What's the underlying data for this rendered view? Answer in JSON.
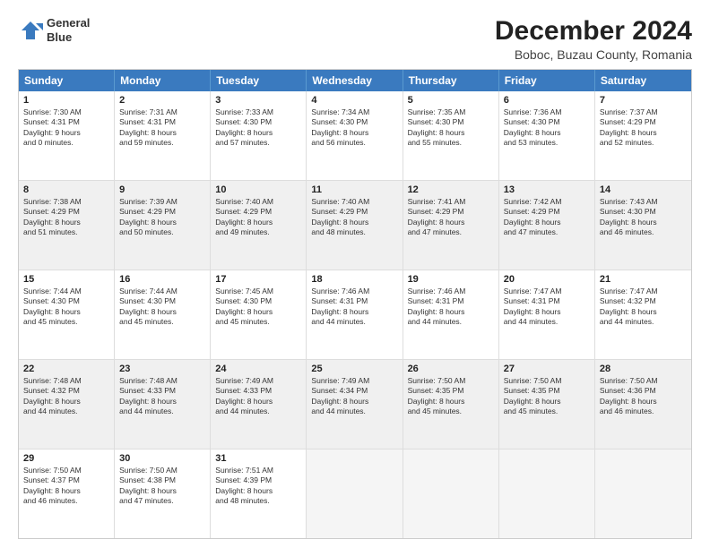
{
  "logo": {
    "line1": "General",
    "line2": "Blue"
  },
  "title": "December 2024",
  "subtitle": "Boboc, Buzau County, Romania",
  "header_days": [
    "Sunday",
    "Monday",
    "Tuesday",
    "Wednesday",
    "Thursday",
    "Friday",
    "Saturday"
  ],
  "rows": [
    [
      {
        "day": "1",
        "lines": [
          "Sunrise: 7:30 AM",
          "Sunset: 4:31 PM",
          "Daylight: 9 hours",
          "and 0 minutes."
        ],
        "shaded": false
      },
      {
        "day": "2",
        "lines": [
          "Sunrise: 7:31 AM",
          "Sunset: 4:31 PM",
          "Daylight: 8 hours",
          "and 59 minutes."
        ],
        "shaded": false
      },
      {
        "day": "3",
        "lines": [
          "Sunrise: 7:33 AM",
          "Sunset: 4:30 PM",
          "Daylight: 8 hours",
          "and 57 minutes."
        ],
        "shaded": false
      },
      {
        "day": "4",
        "lines": [
          "Sunrise: 7:34 AM",
          "Sunset: 4:30 PM",
          "Daylight: 8 hours",
          "and 56 minutes."
        ],
        "shaded": false
      },
      {
        "day": "5",
        "lines": [
          "Sunrise: 7:35 AM",
          "Sunset: 4:30 PM",
          "Daylight: 8 hours",
          "and 55 minutes."
        ],
        "shaded": false
      },
      {
        "day": "6",
        "lines": [
          "Sunrise: 7:36 AM",
          "Sunset: 4:30 PM",
          "Daylight: 8 hours",
          "and 53 minutes."
        ],
        "shaded": false
      },
      {
        "day": "7",
        "lines": [
          "Sunrise: 7:37 AM",
          "Sunset: 4:29 PM",
          "Daylight: 8 hours",
          "and 52 minutes."
        ],
        "shaded": false
      }
    ],
    [
      {
        "day": "8",
        "lines": [
          "Sunrise: 7:38 AM",
          "Sunset: 4:29 PM",
          "Daylight: 8 hours",
          "and 51 minutes."
        ],
        "shaded": true
      },
      {
        "day": "9",
        "lines": [
          "Sunrise: 7:39 AM",
          "Sunset: 4:29 PM",
          "Daylight: 8 hours",
          "and 50 minutes."
        ],
        "shaded": true
      },
      {
        "day": "10",
        "lines": [
          "Sunrise: 7:40 AM",
          "Sunset: 4:29 PM",
          "Daylight: 8 hours",
          "and 49 minutes."
        ],
        "shaded": true
      },
      {
        "day": "11",
        "lines": [
          "Sunrise: 7:40 AM",
          "Sunset: 4:29 PM",
          "Daylight: 8 hours",
          "and 48 minutes."
        ],
        "shaded": true
      },
      {
        "day": "12",
        "lines": [
          "Sunrise: 7:41 AM",
          "Sunset: 4:29 PM",
          "Daylight: 8 hours",
          "and 47 minutes."
        ],
        "shaded": true
      },
      {
        "day": "13",
        "lines": [
          "Sunrise: 7:42 AM",
          "Sunset: 4:29 PM",
          "Daylight: 8 hours",
          "and 47 minutes."
        ],
        "shaded": true
      },
      {
        "day": "14",
        "lines": [
          "Sunrise: 7:43 AM",
          "Sunset: 4:30 PM",
          "Daylight: 8 hours",
          "and 46 minutes."
        ],
        "shaded": true
      }
    ],
    [
      {
        "day": "15",
        "lines": [
          "Sunrise: 7:44 AM",
          "Sunset: 4:30 PM",
          "Daylight: 8 hours",
          "and 45 minutes."
        ],
        "shaded": false
      },
      {
        "day": "16",
        "lines": [
          "Sunrise: 7:44 AM",
          "Sunset: 4:30 PM",
          "Daylight: 8 hours",
          "and 45 minutes."
        ],
        "shaded": false
      },
      {
        "day": "17",
        "lines": [
          "Sunrise: 7:45 AM",
          "Sunset: 4:30 PM",
          "Daylight: 8 hours",
          "and 45 minutes."
        ],
        "shaded": false
      },
      {
        "day": "18",
        "lines": [
          "Sunrise: 7:46 AM",
          "Sunset: 4:31 PM",
          "Daylight: 8 hours",
          "and 44 minutes."
        ],
        "shaded": false
      },
      {
        "day": "19",
        "lines": [
          "Sunrise: 7:46 AM",
          "Sunset: 4:31 PM",
          "Daylight: 8 hours",
          "and 44 minutes."
        ],
        "shaded": false
      },
      {
        "day": "20",
        "lines": [
          "Sunrise: 7:47 AM",
          "Sunset: 4:31 PM",
          "Daylight: 8 hours",
          "and 44 minutes."
        ],
        "shaded": false
      },
      {
        "day": "21",
        "lines": [
          "Sunrise: 7:47 AM",
          "Sunset: 4:32 PM",
          "Daylight: 8 hours",
          "and 44 minutes."
        ],
        "shaded": false
      }
    ],
    [
      {
        "day": "22",
        "lines": [
          "Sunrise: 7:48 AM",
          "Sunset: 4:32 PM",
          "Daylight: 8 hours",
          "and 44 minutes."
        ],
        "shaded": true
      },
      {
        "day": "23",
        "lines": [
          "Sunrise: 7:48 AM",
          "Sunset: 4:33 PM",
          "Daylight: 8 hours",
          "and 44 minutes."
        ],
        "shaded": true
      },
      {
        "day": "24",
        "lines": [
          "Sunrise: 7:49 AM",
          "Sunset: 4:33 PM",
          "Daylight: 8 hours",
          "and 44 minutes."
        ],
        "shaded": true
      },
      {
        "day": "25",
        "lines": [
          "Sunrise: 7:49 AM",
          "Sunset: 4:34 PM",
          "Daylight: 8 hours",
          "and 44 minutes."
        ],
        "shaded": true
      },
      {
        "day": "26",
        "lines": [
          "Sunrise: 7:50 AM",
          "Sunset: 4:35 PM",
          "Daylight: 8 hours",
          "and 45 minutes."
        ],
        "shaded": true
      },
      {
        "day": "27",
        "lines": [
          "Sunrise: 7:50 AM",
          "Sunset: 4:35 PM",
          "Daylight: 8 hours",
          "and 45 minutes."
        ],
        "shaded": true
      },
      {
        "day": "28",
        "lines": [
          "Sunrise: 7:50 AM",
          "Sunset: 4:36 PM",
          "Daylight: 8 hours",
          "and 46 minutes."
        ],
        "shaded": true
      }
    ],
    [
      {
        "day": "29",
        "lines": [
          "Sunrise: 7:50 AM",
          "Sunset: 4:37 PM",
          "Daylight: 8 hours",
          "and 46 minutes."
        ],
        "shaded": false
      },
      {
        "day": "30",
        "lines": [
          "Sunrise: 7:50 AM",
          "Sunset: 4:38 PM",
          "Daylight: 8 hours",
          "and 47 minutes."
        ],
        "shaded": false
      },
      {
        "day": "31",
        "lines": [
          "Sunrise: 7:51 AM",
          "Sunset: 4:39 PM",
          "Daylight: 8 hours",
          "and 48 minutes."
        ],
        "shaded": false
      },
      {
        "day": "",
        "lines": [],
        "shaded": false,
        "empty": true
      },
      {
        "day": "",
        "lines": [],
        "shaded": false,
        "empty": true
      },
      {
        "day": "",
        "lines": [],
        "shaded": false,
        "empty": true
      },
      {
        "day": "",
        "lines": [],
        "shaded": false,
        "empty": true
      }
    ]
  ]
}
